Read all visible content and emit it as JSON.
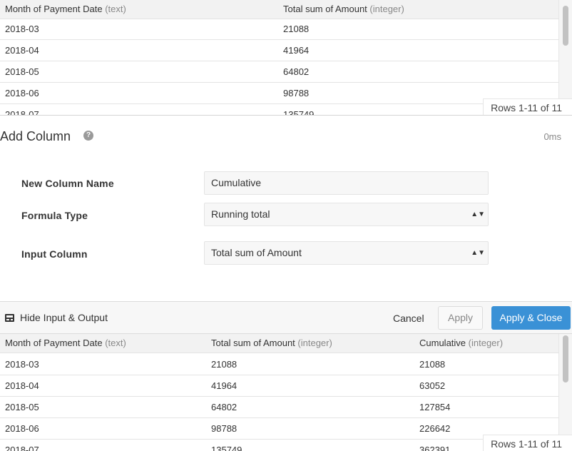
{
  "input_table": {
    "columns": [
      {
        "name": "Month of Payment Date",
        "type": "(text)"
      },
      {
        "name": "Total sum of Amount",
        "type": "(integer)"
      }
    ],
    "rows": [
      [
        "2018-03",
        "21088"
      ],
      [
        "2018-04",
        "41964"
      ],
      [
        "2018-05",
        "64802"
      ],
      [
        "2018-06",
        "98788"
      ],
      [
        "2018-07",
        "135749"
      ]
    ],
    "rows_info": "Rows 1-11 of 11"
  },
  "panel": {
    "title": "Add Column",
    "help_icon": "question-circle-icon",
    "timing": "0ms",
    "fields": {
      "new_column_name": {
        "label": "New Column Name",
        "value": "Cumulative"
      },
      "formula_type": {
        "label": "Formula Type",
        "value": "Running total"
      },
      "input_column": {
        "label": "Input Column",
        "value": "Total sum of Amount"
      }
    }
  },
  "toolbar": {
    "toggle_icon": "table-icon",
    "toggle_label": "Hide Input & Output",
    "cancel_label": "Cancel",
    "apply_label": "Apply",
    "apply_close_label": "Apply & Close",
    "accent_color": "#3a91d6"
  },
  "output_table": {
    "columns": [
      {
        "name": "Month of Payment Date",
        "type": "(text)"
      },
      {
        "name": "Total sum of Amount",
        "type": "(integer)"
      },
      {
        "name": "Cumulative",
        "type": "(integer)"
      }
    ],
    "rows": [
      [
        "2018-03",
        "21088",
        "21088"
      ],
      [
        "2018-04",
        "41964",
        "63052"
      ],
      [
        "2018-05",
        "64802",
        "127854"
      ],
      [
        "2018-06",
        "98788",
        "226642"
      ],
      [
        "2018-07",
        "135749",
        "362391"
      ]
    ],
    "rows_info": "Rows 1-11 of 11"
  }
}
